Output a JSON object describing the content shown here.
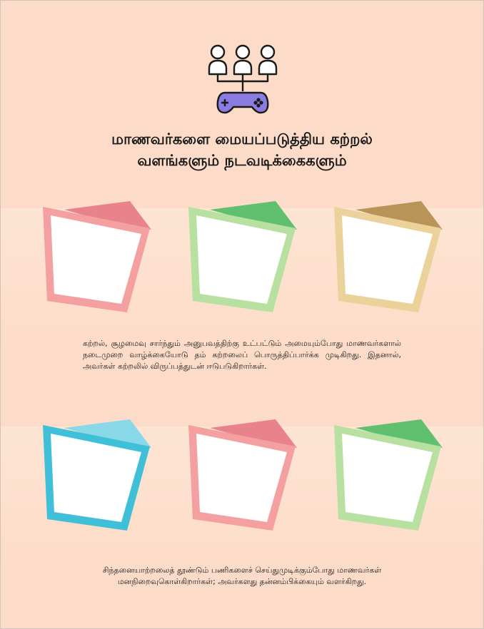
{
  "icon": {
    "name": "people-game-controller-icon",
    "accent": "#8b7de0"
  },
  "title": {
    "line1": "மாணவர்களை மையப்படுத்திய கற்றல்",
    "line2": "வளங்களும் நடவடிக்கைகளும்"
  },
  "cards_row1": [
    {
      "border": "#f4a0a0",
      "flap": "#e8838c"
    },
    {
      "border": "#b8e0a0",
      "flap": "#60c070"
    },
    {
      "border": "#ebd29a",
      "flap": "#b89458"
    }
  ],
  "cards_row2": [
    {
      "border": "#40c0d8",
      "flap": "#88d8e8"
    },
    {
      "border": "#f4a0a0",
      "flap": "#e8838c"
    },
    {
      "border": "#b8e0a0",
      "flap": "#60c070"
    }
  ],
  "paragraph1": "கற்றல், சூழமைவு சார்ந்தும் அனுபவத்திற்கு உட்பட்டும் அமையும்போது மாணவர்களால் நடைமுறை வாழ்க்கையோடு தம் கற்றலைப் பொருத்திப்பார்க்க முடிகிறது. இதனால், அவர்கள் கற்றலில் விருப்பத்துடன் ஈடுபடுகிறார்கள்.",
  "paragraph2": "சிந்தனையாற்றலைத் தூண்டும் பணிகளைச் செய்துமுடிக்கும்போது மாணவர்கள் மனநிறைவுகொள்கிறார்கள்; அவர்களது தன்னம்பிக்கையும் வளர்கிறது."
}
